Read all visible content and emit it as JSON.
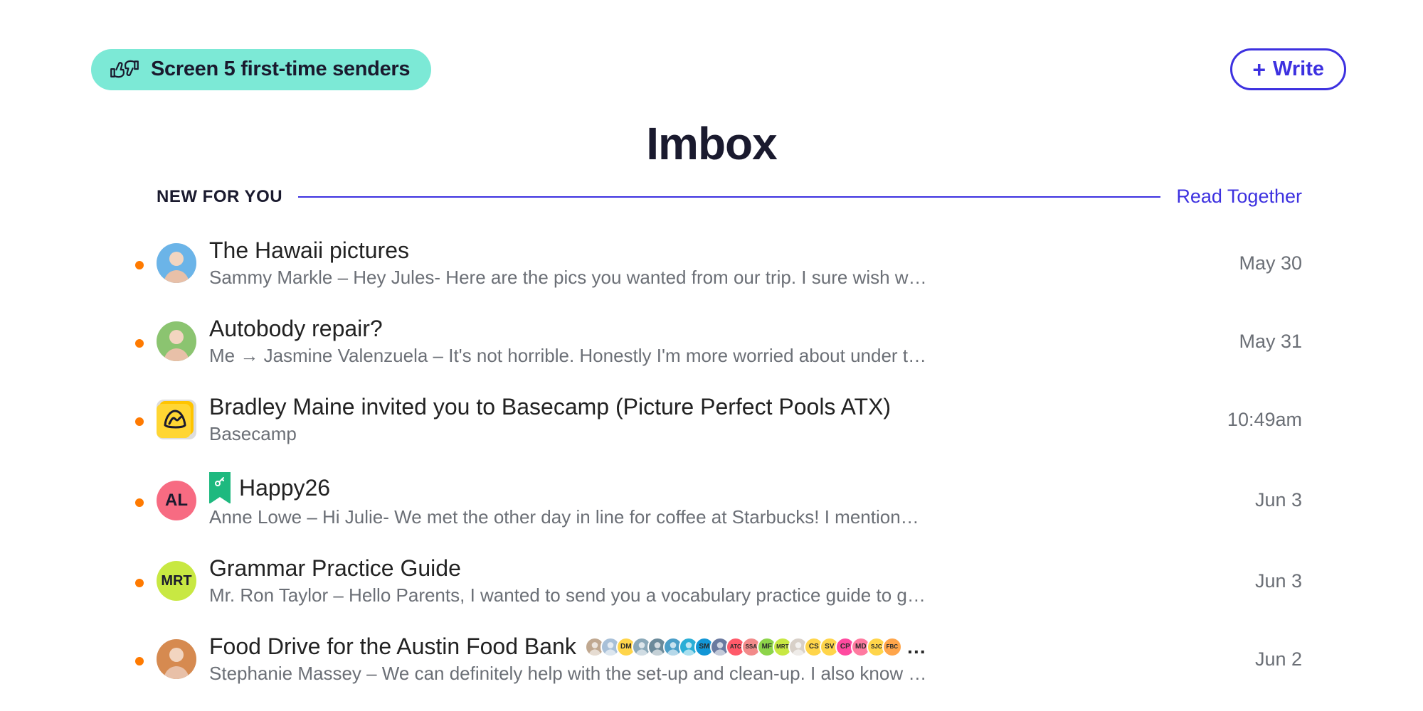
{
  "header": {
    "screener_label": "Screen 5 first-time senders",
    "write_label": "Write"
  },
  "page": {
    "title": "Imbox",
    "section_label": "NEW FOR YOU",
    "read_together": "Read Together"
  },
  "colors": {
    "accent": "#3d31e0",
    "screener_bg": "#7ce9d6",
    "unread_dot": "#ff7a00"
  },
  "emails": [
    {
      "subject": "The Hawaii pictures",
      "preview": "Sammy Markle – Hey Jules- Here are the pics you wanted from our trip. I sure wish we were all ba…",
      "date": "May 30",
      "avatar": {
        "type": "photo",
        "name": "sammy-markle"
      }
    },
    {
      "subject": "Autobody repair?",
      "preview": "Me → Jasmine Valenzuela – It's not horrible. Honestly I'm more worried about under the hood of th…",
      "date": "May 31",
      "avatar": {
        "type": "photo",
        "name": "jasmine-valenzuela"
      }
    },
    {
      "subject": "Bradley Maine invited you to Basecamp (Picture Perfect Pools ATX)",
      "preview": "Basecamp",
      "date": "10:49am",
      "avatar": {
        "type": "brand",
        "name": "basecamp"
      }
    },
    {
      "subject": "Happy26",
      "preview": "Anne Lowe – Hi Julie- We met the other day in line for coffee at Starbucks! I mentioned that I am…",
      "date": "Jun 3",
      "avatar": {
        "type": "initials",
        "initials": "AL",
        "bg": "#f76b82"
      },
      "has_key": true
    },
    {
      "subject": "Grammar Practice Guide",
      "preview": "Mr. Ron Taylor – Hello Parents, I wanted to send you a vocabulary practice guide to go over with you…",
      "date": "Jun 3",
      "avatar": {
        "type": "initials",
        "initials": "MRT",
        "bg": "#c8e842"
      }
    },
    {
      "subject": "Food Drive for the Austin Food Bank",
      "preview": "Stephanie Massey – We can definitely help with the set-up and clean-up. I also know some folks tha…",
      "date": "Jun 2",
      "avatar": {
        "type": "photo",
        "name": "stephanie-massey"
      },
      "chips": [
        {
          "type": "photo",
          "bg": "#c0a890"
        },
        {
          "type": "photo",
          "bg": "#a8c0d8"
        },
        {
          "type": "text",
          "text": "DM",
          "bg": "#ffd54a"
        },
        {
          "type": "photo",
          "bg": "#8aa8b8"
        },
        {
          "type": "photo",
          "bg": "#6b8a9a"
        },
        {
          "type": "photo",
          "bg": "#4a9ec8"
        },
        {
          "type": "photo",
          "bg": "#2aaed6"
        },
        {
          "type": "text",
          "text": "SM",
          "bg": "#1296d6"
        },
        {
          "type": "photo",
          "bg": "#6a7aa0"
        },
        {
          "type": "text",
          "text": "ATC",
          "bg": "#ff5a6a"
        },
        {
          "type": "text",
          "text": "SSA",
          "bg": "#f28a8a"
        },
        {
          "type": "text",
          "text": "MF",
          "bg": "#8dd44a"
        },
        {
          "type": "text",
          "text": "MRT",
          "bg": "#c8e842"
        },
        {
          "type": "photo",
          "bg": "#d8d0c8"
        },
        {
          "type": "text",
          "text": "CS",
          "bg": "#ffd54a"
        },
        {
          "type": "text",
          "text": "SV",
          "bg": "#ffd54a"
        },
        {
          "type": "text",
          "text": "CP",
          "bg": "#ff4aa0"
        },
        {
          "type": "text",
          "text": "MD",
          "bg": "#ff7aa0"
        },
        {
          "type": "text",
          "text": "SJC",
          "bg": "#ffd54a"
        },
        {
          "type": "text",
          "text": "FBC",
          "bg": "#ffa54a"
        }
      ]
    }
  ]
}
